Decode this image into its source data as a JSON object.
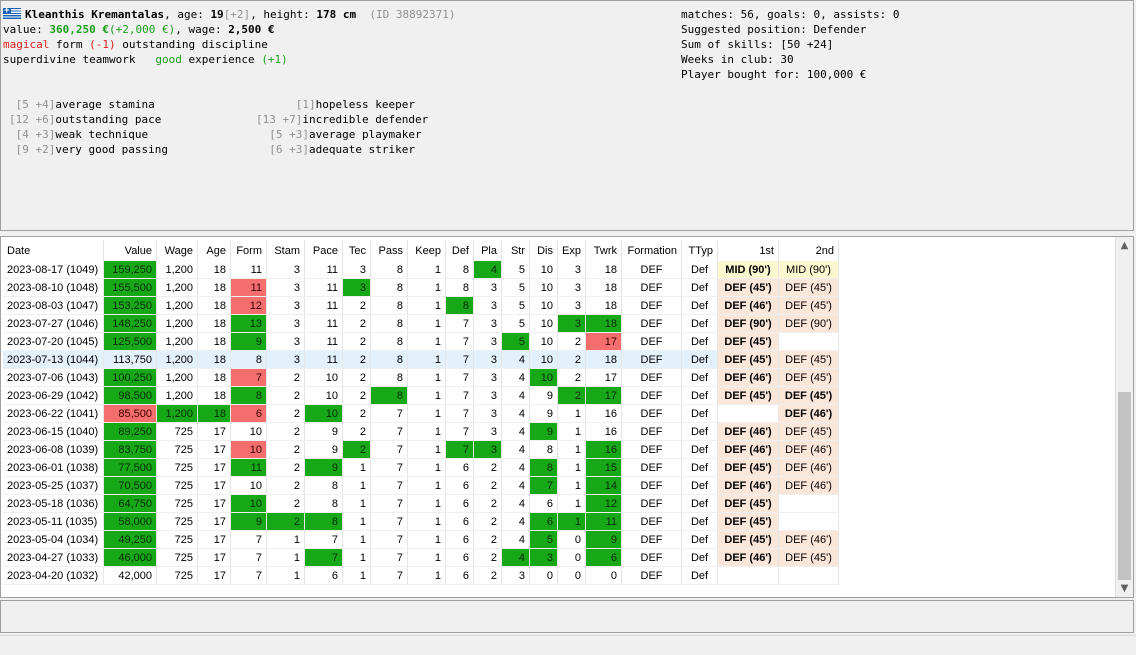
{
  "player": {
    "name": "Kleanthis Kremantalas",
    "age_label": ", age: ",
    "age": "19",
    "age_bonus": "[+2]",
    "height_label": ", height: ",
    "height": "178 cm",
    "id": "(ID 38892371)",
    "value_label": "value: ",
    "value": "360,250 €",
    "value_change": "(+2,000 €)",
    "wage_label": ", wage: ",
    "wage": "2,500 €",
    "form": "magical",
    "form_label": " form ",
    "form_change": "(-1)",
    "discipline_quality": " outstanding discipline",
    "teamwork_quality": "superdivine teamwork",
    "experience_quality": "good",
    "experience_label": " experience ",
    "experience_change": "(+1)"
  },
  "stats": {
    "matches": "matches: 56, goals: 0, assists: 0",
    "position": "Suggested position: Defender",
    "skills_sum": "Sum of skills: [50 +24]",
    "weeks": "Weeks in club: 30",
    "bought": "Player bought for: 100,000 €"
  },
  "skills_left": [
    {
      "value": " [5 +4]",
      "label": "average stamina"
    },
    {
      "value": "[12 +6]",
      "label": "outstanding pace"
    },
    {
      "value": " [4 +3]",
      "label": "weak technique"
    },
    {
      "value": " [9 +2]",
      "label": "very good passing"
    }
  ],
  "skills_right": [
    {
      "value": "      [1]",
      "label": "hopeless keeper"
    },
    {
      "value": "[13 +7]",
      "label": "incredible defender"
    },
    {
      "value": "  [5 +3]",
      "label": "average playmaker"
    },
    {
      "value": "  [6 +3]",
      "label": "adequate striker"
    }
  ],
  "table": {
    "headers": [
      "Date",
      "Value",
      "Wage",
      "Age",
      "Form",
      "Stam",
      "Pace",
      "Tec",
      "Pass",
      "Keep",
      "Def",
      "Pla",
      "Str",
      "Dis",
      "Exp",
      "Twrk",
      "Formation",
      "TTyp",
      "1st",
      "2nd"
    ],
    "rows": [
      {
        "cells": [
          "2023-08-17 (1049)",
          "159,250",
          "1,200",
          "18",
          "11",
          "3",
          "11",
          "3",
          "8",
          "1",
          "8",
          "4",
          "5",
          "10",
          "3",
          "18",
          "DEF",
          "Def",
          "MID (90')",
          "MID (90')"
        ],
        "hl": {
          "1": "g",
          "11": "g"
        },
        "p1": "y",
        "p2": "y2"
      },
      {
        "cells": [
          "2023-08-10 (1048)",
          "155,500",
          "1,200",
          "18",
          "11",
          "3",
          "11",
          "3",
          "8",
          "1",
          "8",
          "3",
          "5",
          "10",
          "3",
          "18",
          "DEF",
          "Def",
          "DEF (45')",
          "DEF (45')"
        ],
        "hl": {
          "1": "g",
          "4": "rd",
          "7": "g"
        },
        "p1": "o",
        "p2": "o2"
      },
      {
        "cells": [
          "2023-08-03 (1047)",
          "153,250",
          "1,200",
          "18",
          "12",
          "3",
          "11",
          "2",
          "8",
          "1",
          "8",
          "3",
          "5",
          "10",
          "3",
          "18",
          "DEF",
          "Def",
          "DEF (46')",
          "DEF (45')"
        ],
        "hl": {
          "1": "g",
          "4": "rd",
          "10": "g"
        },
        "p1": "o",
        "p2": "o2"
      },
      {
        "cells": [
          "2023-07-27 (1046)",
          "148,250",
          "1,200",
          "18",
          "13",
          "3",
          "11",
          "2",
          "8",
          "1",
          "7",
          "3",
          "5",
          "10",
          "3",
          "18",
          "DEF",
          "Def",
          "DEF (90')",
          "DEF (90')"
        ],
        "hl": {
          "1": "g",
          "4": "g",
          "14": "g",
          "15": "g"
        },
        "p1": "o",
        "p2": "o2"
      },
      {
        "cells": [
          "2023-07-20 (1045)",
          "125,500",
          "1,200",
          "18",
          "9",
          "3",
          "11",
          "2",
          "8",
          "1",
          "7",
          "3",
          "5",
          "10",
          "2",
          "17",
          "DEF",
          "Def",
          "DEF (45')",
          ""
        ],
        "hl": {
          "1": "g",
          "4": "g",
          "12": "g",
          "15": "rd"
        },
        "p1": "o",
        "p2": ""
      },
      {
        "cells": [
          "2023-07-13 (1044)",
          "113,750",
          "1,200",
          "18",
          "8",
          "3",
          "11",
          "2",
          "8",
          "1",
          "7",
          "3",
          "4",
          "10",
          "2",
          "18",
          "DEF",
          "Def",
          "DEF (45')",
          "DEF (45')"
        ],
        "hl": {},
        "p1": "o",
        "p2": "o2",
        "sel": true
      },
      {
        "cells": [
          "2023-07-06 (1043)",
          "100,250",
          "1,200",
          "18",
          "7",
          "2",
          "10",
          "2",
          "8",
          "1",
          "7",
          "3",
          "4",
          "10",
          "2",
          "17",
          "DEF",
          "Def",
          "DEF (46')",
          "DEF (45')"
        ],
        "hl": {
          "1": "g",
          "4": "rd",
          "13": "g"
        },
        "p1": "o",
        "p2": "o2"
      },
      {
        "cells": [
          "2023-06-29 (1042)",
          "98,500",
          "1,200",
          "18",
          "8",
          "2",
          "10",
          "2",
          "8",
          "1",
          "7",
          "3",
          "4",
          "9",
          "2",
          "17",
          "DEF",
          "Def",
          "DEF (45')",
          "DEF (45')"
        ],
        "hl": {
          "1": "g",
          "4": "g",
          "8": "g",
          "14": "g",
          "15": "g"
        },
        "p1": "o",
        "p2": "o"
      },
      {
        "cells": [
          "2023-06-22 (1041)",
          "85,500",
          "1,200",
          "18",
          "6",
          "2",
          "10",
          "2",
          "7",
          "1",
          "7",
          "3",
          "4",
          "9",
          "1",
          "16",
          "DEF",
          "Def",
          "",
          "DEF (46')"
        ],
        "hl": {
          "1": "rd",
          "2": "g",
          "3": "g",
          "4": "rd",
          "6": "g"
        },
        "p1": "",
        "p2": "o"
      },
      {
        "cells": [
          "2023-06-15 (1040)",
          "89,250",
          "725",
          "17",
          "10",
          "2",
          "9",
          "2",
          "7",
          "1",
          "7",
          "3",
          "4",
          "9",
          "1",
          "16",
          "DEF",
          "Def",
          "DEF (46')",
          "DEF (45')"
        ],
        "hl": {
          "1": "g",
          "13": "g"
        },
        "p1": "o",
        "p2": "o2"
      },
      {
        "cells": [
          "2023-06-08 (1039)",
          "83,750",
          "725",
          "17",
          "10",
          "2",
          "9",
          "2",
          "7",
          "1",
          "7",
          "3",
          "4",
          "8",
          "1",
          "16",
          "DEF",
          "Def",
          "DEF (46')",
          "DEF (46')"
        ],
        "hl": {
          "1": "g",
          "4": "rd",
          "7": "g",
          "10": "g",
          "11": "g",
          "15": "g"
        },
        "p1": "o",
        "p2": "o2"
      },
      {
        "cells": [
          "2023-06-01 (1038)",
          "77,500",
          "725",
          "17",
          "11",
          "2",
          "9",
          "1",
          "7",
          "1",
          "6",
          "2",
          "4",
          "8",
          "1",
          "15",
          "DEF",
          "Def",
          "DEF (45')",
          "DEF (46')"
        ],
        "hl": {
          "1": "g",
          "4": "g",
          "6": "g",
          "13": "g",
          "15": "g"
        },
        "p1": "o",
        "p2": "o2"
      },
      {
        "cells": [
          "2023-05-25 (1037)",
          "70,500",
          "725",
          "17",
          "10",
          "2",
          "8",
          "1",
          "7",
          "1",
          "6",
          "2",
          "4",
          "7",
          "1",
          "14",
          "DEF",
          "Def",
          "DEF (46')",
          "DEF (46')"
        ],
        "hl": {
          "1": "g",
          "13": "g",
          "15": "g"
        },
        "p1": "o",
        "p2": "o2"
      },
      {
        "cells": [
          "2023-05-18 (1036)",
          "64,750",
          "725",
          "17",
          "10",
          "2",
          "8",
          "1",
          "7",
          "1",
          "6",
          "2",
          "4",
          "6",
          "1",
          "12",
          "DEF",
          "Def",
          "DEF (45')",
          ""
        ],
        "hl": {
          "1": "g",
          "4": "g",
          "15": "g"
        },
        "p1": "o",
        "p2": ""
      },
      {
        "cells": [
          "2023-05-11 (1035)",
          "58,000",
          "725",
          "17",
          "9",
          "2",
          "8",
          "1",
          "7",
          "1",
          "6",
          "2",
          "4",
          "6",
          "1",
          "11",
          "DEF",
          "Def",
          "DEF (45')",
          ""
        ],
        "hl": {
          "1": "g",
          "4": "g",
          "5": "g",
          "6": "g",
          "13": "g",
          "14": "g",
          "15": "g"
        },
        "p1": "o",
        "p2": ""
      },
      {
        "cells": [
          "2023-05-04 (1034)",
          "49,250",
          "725",
          "17",
          "7",
          "1",
          "7",
          "1",
          "7",
          "1",
          "6",
          "2",
          "4",
          "5",
          "0",
          "9",
          "DEF",
          "Def",
          "DEF (45')",
          "DEF (46')"
        ],
        "hl": {
          "1": "g",
          "13": "g",
          "15": "g"
        },
        "p1": "o",
        "p2": "o2"
      },
      {
        "cells": [
          "2023-04-27 (1033)",
          "46,000",
          "725",
          "17",
          "7",
          "1",
          "7",
          "1",
          "7",
          "1",
          "6",
          "2",
          "4",
          "3",
          "0",
          "6",
          "DEF",
          "Def",
          "DEF (46')",
          "DEF (45')"
        ],
        "hl": {
          "1": "g",
          "6": "g",
          "12": "g",
          "13": "g",
          "15": "g"
        },
        "p1": "o",
        "p2": "o2"
      },
      {
        "cells": [
          "2023-04-20 (1032)",
          "42,000",
          "725",
          "17",
          "7",
          "1",
          "6",
          "1",
          "7",
          "1",
          "6",
          "2",
          "3",
          "0",
          "0",
          "0",
          "DEF",
          "Def",
          "",
          ""
        ],
        "hl": {},
        "p1": "",
        "p2": ""
      }
    ]
  },
  "scroll": {
    "up_icon": "▲",
    "down_icon": "▼"
  }
}
